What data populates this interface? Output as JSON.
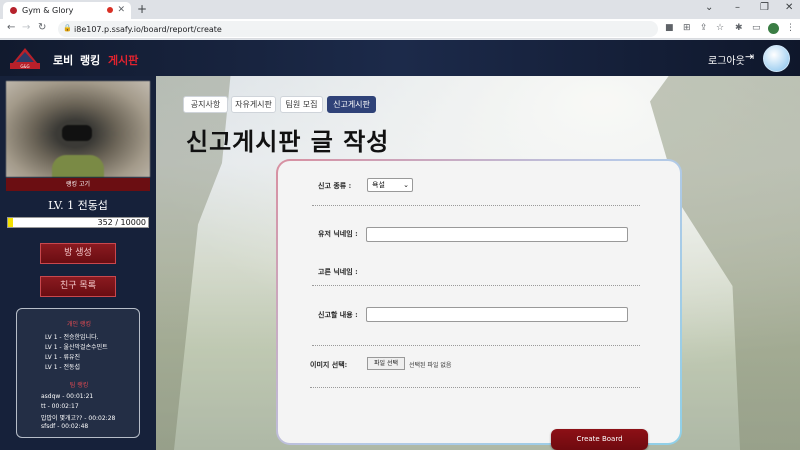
{
  "browser": {
    "tab_title": "Gym & Glory",
    "new_tab": "+",
    "url": "i8e107.p.ssafy.io/board/report/create",
    "window_controls": [
      "⌄",
      "–",
      "❐",
      "✕"
    ]
  },
  "nav": {
    "links": [
      "로비",
      "랭킹",
      "게시판"
    ],
    "active": "게시판",
    "logout": "로그아웃"
  },
  "sidebar": {
    "rank_label": "랭킹 고기",
    "level_text": "LV. 1 전동섭",
    "exp_current": 352,
    "exp_max": 10000,
    "exp_text": "352 / 10000",
    "buttons": [
      "방 생성",
      "친구 목록"
    ],
    "personal_ranking_title": "개인 랭킹",
    "personal_ranking": [
      "LV 1 - 전승한입니다.",
      "LV 1 - 울산막걸손수민트",
      "LV 1 - 류유진",
      "LV 1 - 전동섭"
    ],
    "time_ranking_title": "팀 랭킹",
    "time_ranking": [
      "asdqw - 00:01:21",
      "tt - 00:02:17",
      "밥밥이 몇개고?? - 00:02:28",
      "sfsdf - 00:02:48"
    ]
  },
  "board_tabs": [
    {
      "label": "공지사항",
      "active": false
    },
    {
      "label": "자유게시판",
      "active": false
    },
    {
      "label": "팀원 모집",
      "active": false
    },
    {
      "label": "신고게시판",
      "active": true
    }
  ],
  "page_title": "신고게시판 글 작성",
  "form": {
    "type_label": "신고 종류 :",
    "type_value": "욕설",
    "user_nick_label": "유저 닉네임 :",
    "user_nick_value": "",
    "other_nick_label": "고른 닉네임 :",
    "content_label": "신고할 내용 :",
    "content_value": "",
    "image_label": "이미지 선택:",
    "file_button": "파일 선택",
    "file_status": "선택된 파일 없음",
    "submit": "Create Board"
  },
  "colors": {
    "nav_bg": "#16213a",
    "accent_red": "#7a0c12",
    "active_tab": "#2f4278",
    "exp_yellow": "#f3e000"
  }
}
